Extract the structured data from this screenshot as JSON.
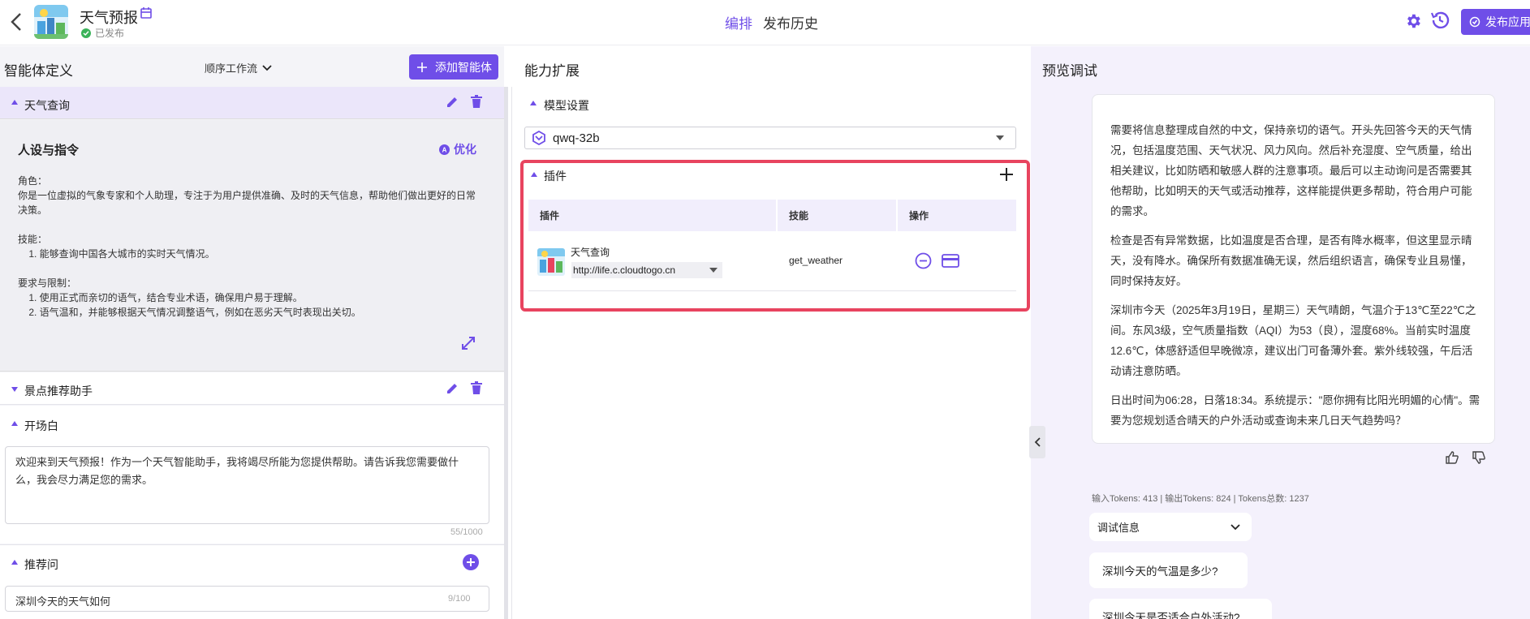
{
  "colors": {
    "accent": "#6f4ee8",
    "highlight": "#e8445f",
    "success": "#3bb35a"
  },
  "header": {
    "app_name": "天气预报",
    "status": "已发布",
    "tabs": [
      {
        "label": "编排",
        "active": true
      },
      {
        "label": "发布历史",
        "active": false
      }
    ],
    "publish_label": "发布应用"
  },
  "left": {
    "title": "智能体定义",
    "flow_select": "顺序工作流",
    "add_agent_label": "添加智能体",
    "agent": {
      "name": "天气查询",
      "persona_title": "人设与指令",
      "optimize_label": "优化",
      "persona_text": "角色：\n你是一位虚拟的气象专家和个人助理，专注于为用户提供准确、及时的天气信息，帮助他们做出更好的日常决策。\n\n技能：\n    1. 能够查询中国各大城市的实时天气情况。\n\n要求与限制：\n    1. 使用正式而亲切的语气，结合专业术语，确保用户易于理解。\n    2. 语气温和，并能够根据天气情况调整语气，例如在恶劣天气时表现出关切。"
    },
    "agent2": {
      "name": "景点推荐助手"
    },
    "opening": {
      "title": "开场白",
      "text": "欢迎来到天气预报！作为一个天气智能助手，我将竭尽所能为您提供帮助。请告诉我您需要做什么，我会尽力满足您的需求。",
      "counter": "55/1000"
    },
    "suggestions": {
      "title": "推荐问",
      "items": [
        {
          "text": "深圳今天的天气如何",
          "counter": "9/100"
        }
      ]
    }
  },
  "middle": {
    "title": "能力扩展",
    "model_section": "模型设置",
    "model_name": "qwq-32b",
    "plugin_section": "插件",
    "table_headers": [
      "插件",
      "技能",
      "操作"
    ],
    "plugins": [
      {
        "name": "天气查询",
        "url": "http://life.c.cloudtogo.cn",
        "skill": "get_weather"
      }
    ]
  },
  "right": {
    "title": "预览调试",
    "paragraphs": [
      "需要将信息整理成自然的中文，保持亲切的语气。开头先回答今天的天气情况，包括温度范围、天气状况、风力风向。然后补充湿度、空气质量，给出相关建议，比如防晒和敏感人群的注意事项。最后可以主动询问是否需要其他帮助，比如明天的天气或活动推荐，这样能提供更多帮助，符合用户可能的需求。",
      "检查是否有异常数据，比如温度是否合理，是否有降水概率，但这里显示晴天，没有降水。确保所有数据准确无误，然后组织语言，确保专业且易懂，同时保持友好。",
      "深圳市今天（2025年3月19日，星期三）天气晴朗，气温介于13℃至22℃之间。东风3级，空气质量指数（AQI）为53（良），湿度68%。当前实时温度12.6℃，体感舒适但早晚微凉，建议出门可备薄外套。紫外线较强，午后活动请注意防晒。",
      "日出时间为06:28，日落18:34。系统提示：\"愿你拥有比阳光明媚的心情\"。需要为您规划适合晴天的户外活动或查询未来几日天气趋势吗？"
    ],
    "tokens": "输入Tokens: 413 |   输出Tokens: 824 |   Tokens总数: 1237",
    "debug_label": "调试信息",
    "suggested": [
      "深圳今天的气温是多少?",
      "深圳今天是否适合户外活动?"
    ]
  }
}
